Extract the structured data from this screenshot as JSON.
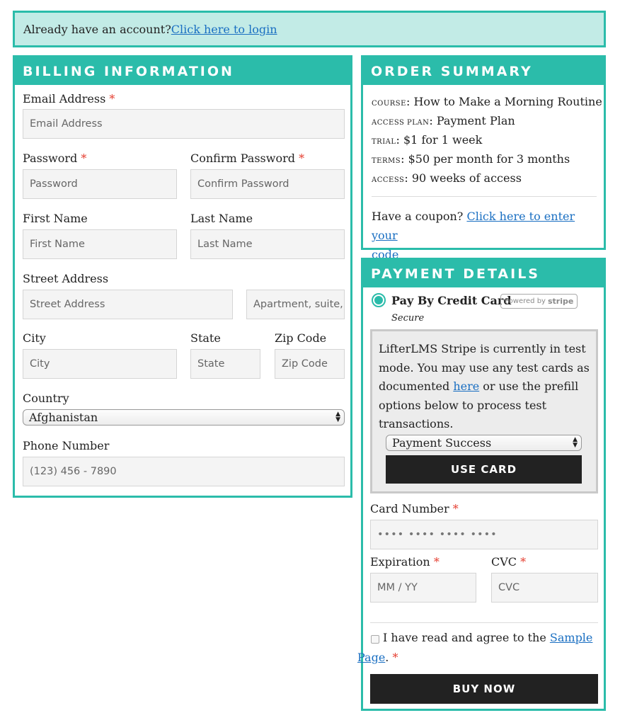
{
  "login_notice": {
    "text": "Already have an account? ",
    "link": "Click here to login"
  },
  "billing": {
    "title": "BILLING INFORMATION",
    "required_mark": "*",
    "email": {
      "label": "Email Address",
      "placeholder": "Email Address"
    },
    "password": {
      "label": "Password",
      "placeholder": "Password"
    },
    "confirm_password": {
      "label": "Confirm Password",
      "placeholder": "Confirm Password"
    },
    "first_name": {
      "label": "First Name",
      "placeholder": "First Name"
    },
    "last_name": {
      "label": "Last Name",
      "placeholder": "Last Name"
    },
    "street": {
      "label": "Street Address",
      "placeholder": "Street Address",
      "placeholder2": "Apartment, suite, or unit"
    },
    "city": {
      "label": "City",
      "placeholder": "City"
    },
    "state": {
      "label": "State",
      "placeholder": "State"
    },
    "zip": {
      "label": "Zip Code",
      "placeholder": "Zip Code"
    },
    "country": {
      "label": "Country",
      "value": "Afghanistan"
    },
    "phone": {
      "label": "Phone Number",
      "placeholder": "(123) 456 - 7890"
    }
  },
  "summary": {
    "title": "ORDER SUMMARY",
    "rows": [
      {
        "key": "Course",
        "value": "How to Make a Morning Routine"
      },
      {
        "key": "Access Plan",
        "value": "Payment Plan"
      },
      {
        "key": "Trial",
        "value": "$1 for 1 week"
      },
      {
        "key": "Terms",
        "value": "$50 per month for 3 months"
      },
      {
        "key": "Access",
        "value": "90 weeks of access"
      }
    ],
    "coupon_text": "Have a coupon? ",
    "coupon_link_1": "Click here to enter your",
    "coupon_link_2": "code"
  },
  "payment": {
    "title": "PAYMENT DETAILS",
    "method_label": "Pay By Credit Card",
    "stripe_badge_prefix": "Powered by",
    "stripe_badge_brand": "stripe",
    "secure": "Secure",
    "test_lines": [
      "LifterLMS Stripe is currently in test",
      "mode. You may use any test cards as",
      "documented ",
      " or use the prefill",
      "options below to process test",
      "transactions."
    ],
    "test_link": "here",
    "prefill_value": "Payment Success",
    "use_card": "USE CARD",
    "card_number": {
      "label": "Card Number",
      "placeholder": "•••• •••• •••• ••••"
    },
    "expiration": {
      "label": "Expiration",
      "placeholder": "MM / YY"
    },
    "cvc": {
      "label": "CVC",
      "placeholder": "CVC"
    },
    "agree_text": "I have read and agree to the ",
    "agree_link_1": "Sample",
    "agree_link_2": "Page",
    "agree_suffix": ".",
    "buy_now": "BUY NOW"
  },
  "colors": {
    "accent": "#2bbcaa",
    "notice_bg": "#c2ebe6",
    "link": "#1a6fc2",
    "required": "#e53d2f",
    "button": "#222222"
  }
}
